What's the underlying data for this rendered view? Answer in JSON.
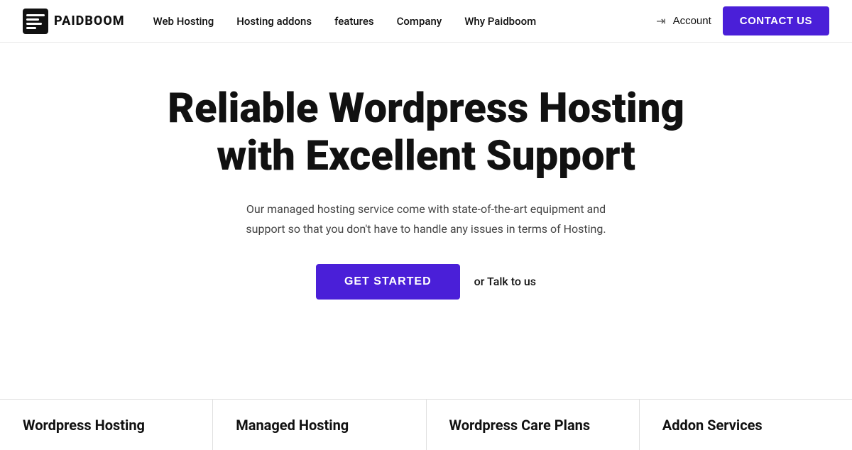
{
  "navbar": {
    "logo_text": "PAIDBOOM",
    "links": [
      {
        "label": "Web Hosting",
        "id": "web-hosting"
      },
      {
        "label": "Hosting addons",
        "id": "hosting-addons"
      },
      {
        "label": "features",
        "id": "features"
      },
      {
        "label": "Company",
        "id": "company"
      },
      {
        "label": "Why Paidboom",
        "id": "why-paidboom"
      }
    ],
    "account_label": "Account",
    "contact_label": "CONTACT US"
  },
  "hero": {
    "title": "Reliable Wordpress Hosting with Excellent Support",
    "subtitle": "Our managed hosting service come with state-of-the-art equipment and support so that you don't have to handle any issues in terms of Hosting.",
    "cta_label": "GET STARTED",
    "talk_label": "or Talk to us"
  },
  "bottom_cards": [
    {
      "label": "Wordpress Hosting"
    },
    {
      "label": "Managed Hosting"
    },
    {
      "label": "Wordpress Care Plans"
    },
    {
      "label": "Addon Services"
    }
  ],
  "colors": {
    "accent": "#4a1fd8",
    "text_dark": "#111111",
    "text_mid": "#444444",
    "border": "#e0e0e0"
  }
}
